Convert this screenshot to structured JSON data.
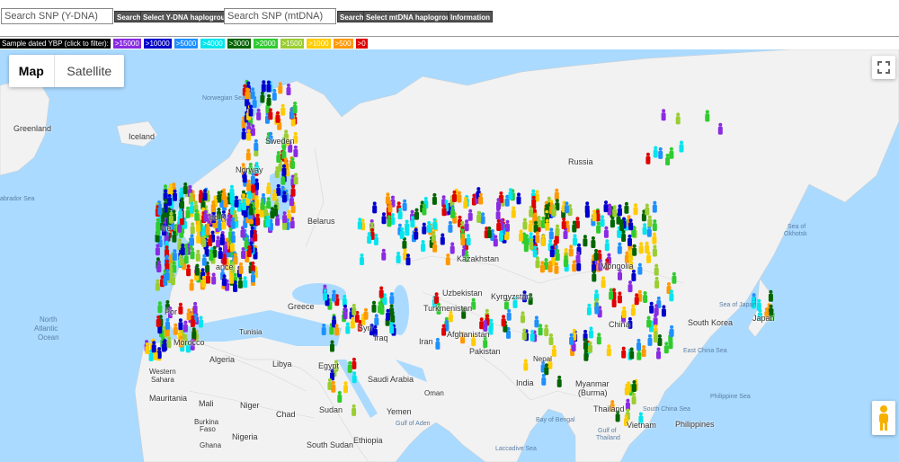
{
  "toolbar": {
    "y_search_placeholder": "Search SNP (Y-DNA)",
    "y_search_button": "Search",
    "y_select_button": "Select Y-DNA haplogroup",
    "mt_search_placeholder": "Search SNP (mtDNA)",
    "mt_search_button": "Search",
    "mt_select_button": "Select mtDNA haplogroup",
    "info_button": "Information"
  },
  "legend": {
    "title": "Sample dated YBP (click to filter):",
    "chips": [
      {
        "label": ">15000",
        "color": "#8a2be2"
      },
      {
        "label": ">10000",
        "color": "#0000cd"
      },
      {
        "label": ">5000",
        "color": "#1e90ff"
      },
      {
        "label": ">4000",
        "color": "#00e5ee"
      },
      {
        "label": ">3000",
        "color": "#006400"
      },
      {
        "label": ">2000",
        "color": "#2ecc2e"
      },
      {
        "label": ">1500",
        "color": "#9acd32"
      },
      {
        "label": ">1000",
        "color": "#ffcc00"
      },
      {
        "label": ">500",
        "color": "#ff9900"
      },
      {
        "label": ">0",
        "color": "#e00000"
      }
    ]
  },
  "map_controls": {
    "map_label": "Map",
    "satellite_label": "Satellite",
    "fullscreen_icon": "fullscreen-icon",
    "pegman_icon": "pegman-icon"
  },
  "map_labels": {
    "greenland": "Greenland",
    "iceland": "Iceland",
    "norway": "Norway",
    "sweden": "Sweden",
    "russia": "Russia",
    "belarus": "Belarus",
    "ireland": "Ire",
    "united_kingdom": "ed K",
    "france": "ance",
    "portugal": "Por",
    "greece": "Greece",
    "kazakhstan": "Kazakhstan",
    "uzbekistan": "Uzbekistan",
    "kyrgyzstan": "Kyrgyzstan",
    "turkmenistan": "Turkmenistan",
    "mongolia": "Mongolia",
    "china": "China",
    "south_korea": "South Korea",
    "japan": "Japan",
    "afghanistan": "Afghanistan",
    "pakistan": "Pakistan",
    "iran": "Iran",
    "iraq": "Iraq",
    "syria": "Syri",
    "nepal": "Nepal",
    "india": "India",
    "myanmar": "Myanmar",
    "burma": "(Burma)",
    "thailand": "Thailand",
    "vietnam": "Vietnam",
    "philippines": "Philippines",
    "morocco": "Morocco",
    "algeria": "Algeria",
    "tunisia": "Tunisia",
    "libya": "Libya",
    "egypt": "Egypt",
    "western_sahara_1": "Western",
    "western_sahara_2": "Sahara",
    "mauritania": "Mauritania",
    "mali": "Mali",
    "niger": "Niger",
    "chad": "Chad",
    "sudan": "Sudan",
    "south_sudan": "South Sudan",
    "ethiopia": "Ethiopia",
    "nigeria": "Nigeria",
    "burkina_1": "Burkina",
    "burkina_2": "Faso",
    "ghana": "Ghana",
    "saudi_arabia": "Saudi Arabia",
    "yemen": "Yemen",
    "oman": "Oman",
    "north_atlantic_1": "North",
    "north_atlantic_2": "Atlantic",
    "north_atlantic_3": "Ocean",
    "norwegian_sea": "Norwegian Sea",
    "labrador_sea": "abrador Sea",
    "sea_of_okhotsk_1": "Sea of",
    "sea_of_okhotsk_2": "Okhotsk",
    "sea_of_japan": "Sea of Japan",
    "east_china_sea": "East China Sea",
    "philippine_sea": "Philippine Sea",
    "bay_of_bengal": "Bay of Bengal",
    "south_china_sea": "South China Sea",
    "gulf_of_aden": "Gulf of Aden",
    "laccadive_sea": "Laccadive Sea",
    "gulf_of_thailand_1": "Gulf of",
    "gulf_of_thailand_2": "Thailand"
  }
}
